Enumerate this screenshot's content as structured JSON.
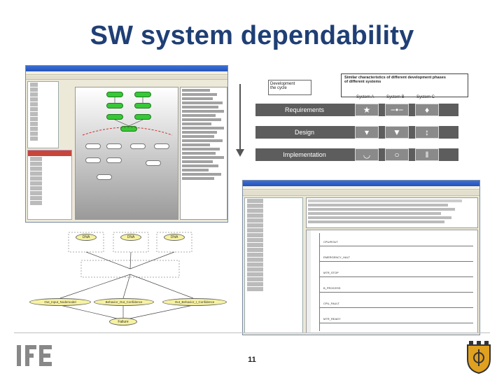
{
  "slide": {
    "title": "SW system dependability",
    "page_number": "11"
  },
  "diagram_box": {
    "development_label": "Development\nthe cycle",
    "similar_label": "Similar characteristics of different development phases\nof different systems",
    "systems": [
      "System A",
      "System B",
      "System C"
    ],
    "phases": [
      "Requirements",
      "Design",
      "Implementation"
    ],
    "symbols": [
      [
        "★",
        "−•−",
        "♦"
      ],
      [
        "▾",
        "▼",
        "↕"
      ],
      [
        "◡",
        "○",
        "‖"
      ]
    ]
  },
  "network_diagram": {
    "top_nodes": [
      "DNA",
      "DNA",
      "DNA"
    ],
    "top_labels": [
      " ",
      " ",
      " "
    ],
    "bottom_nodes": [
      "Out_Input_Nodemodel",
      "Behavior_Out_Confidence",
      "Out_Behavior_I_Confidence"
    ],
    "final_node": "Failure"
  },
  "ladder": {
    "rungs": [
      "CPU/ROUT",
      "EMERGENCY_HALT",
      "MTR_STOP",
      "B_PROCESS",
      "CPU_FAULT",
      "MTR_READY"
    ]
  },
  "logo": {
    "text": "IFE"
  }
}
